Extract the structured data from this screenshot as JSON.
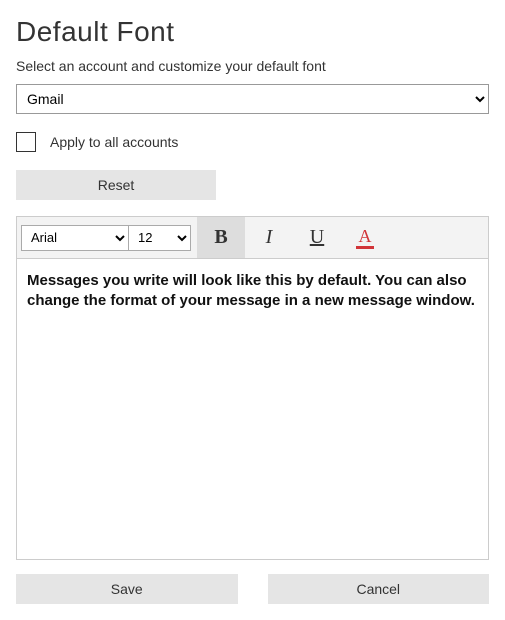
{
  "title": "Default Font",
  "subtitle": "Select an account and customize your default font",
  "account_selected": "Gmail",
  "apply_all_label": "Apply to all accounts",
  "reset_label": "Reset",
  "toolbar": {
    "font_family": "Arial",
    "font_size": "12",
    "bold_glyph": "B",
    "italic_glyph": "I",
    "underline_glyph": "U",
    "color_glyph": "A"
  },
  "preview_text": "Messages you write will look like this by default. You can also change the format of your message in a new message window.",
  "save_label": "Save",
  "cancel_label": "Cancel"
}
